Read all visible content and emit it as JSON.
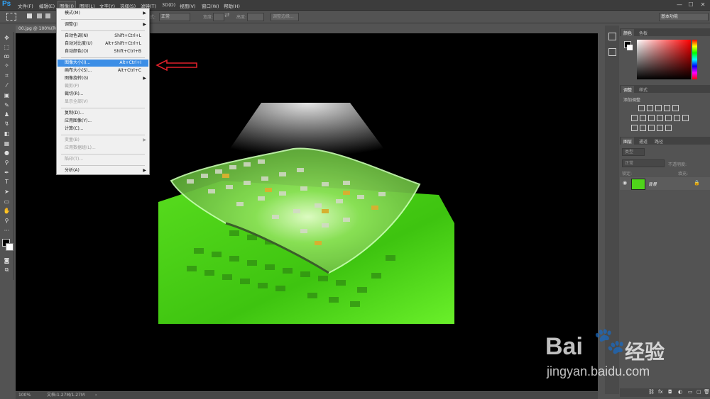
{
  "app": {
    "logo": "Ps"
  },
  "menubar": {
    "items": [
      "文件(F)",
      "编辑(E)",
      "图像(I)",
      "图层(L)",
      "文字(Y)",
      "选择(S)",
      "滤镜(T)",
      "3D(D)",
      "视图(V)",
      "窗口(W)",
      "帮助(H)"
    ],
    "window_controls": [
      "—",
      "☐",
      "✕"
    ]
  },
  "options": {
    "style_suffix": "式:",
    "mode_value": "正常",
    "width_label": "宽度:",
    "height_label": "高度:",
    "adjust_edge": "调整边缘...",
    "workspace": "基本功能"
  },
  "document": {
    "tab_title": "00.jpg @ 100%(RGB/8)"
  },
  "status": {
    "zoom": "100%",
    "doc_info": "文档:1.27M/1.27M",
    "arrow": "›"
  },
  "dropdown": {
    "items": [
      {
        "label": "模式(M)",
        "shortcut": "",
        "submenu": true,
        "disabled": false
      },
      {
        "sep": true
      },
      {
        "label": "调整(J)",
        "shortcut": "",
        "submenu": true,
        "disabled": false
      },
      {
        "sep": true
      },
      {
        "label": "自动色调(N)",
        "shortcut": "Shift+Ctrl+L",
        "submenu": false,
        "disabled": false
      },
      {
        "label": "自动对比度(U)",
        "shortcut": "Alt+Shift+Ctrl+L",
        "submenu": false,
        "disabled": false
      },
      {
        "label": "自动颜色(O)",
        "shortcut": "Shift+Ctrl+B",
        "submenu": false,
        "disabled": false
      },
      {
        "sep": true
      },
      {
        "label": "图像大小(I)...",
        "shortcut": "Alt+Ctrl+I",
        "submenu": false,
        "disabled": false,
        "highlight": true
      },
      {
        "label": "画布大小(S)...",
        "shortcut": "Alt+Ctrl+C",
        "submenu": false,
        "disabled": false
      },
      {
        "label": "图像旋转(G)",
        "shortcut": "",
        "submenu": true,
        "disabled": false
      },
      {
        "label": "裁剪(P)",
        "shortcut": "",
        "submenu": false,
        "disabled": true
      },
      {
        "label": "裁切(R)...",
        "shortcut": "",
        "submenu": false,
        "disabled": false
      },
      {
        "label": "显示全部(V)",
        "shortcut": "",
        "submenu": false,
        "disabled": true
      },
      {
        "sep": true
      },
      {
        "label": "复制(D)...",
        "shortcut": "",
        "submenu": false,
        "disabled": false
      },
      {
        "label": "应用图像(Y)...",
        "shortcut": "",
        "submenu": false,
        "disabled": false
      },
      {
        "label": "计算(C)...",
        "shortcut": "",
        "submenu": false,
        "disabled": false
      },
      {
        "sep": true
      },
      {
        "label": "变量(B)",
        "shortcut": "",
        "submenu": true,
        "disabled": true
      },
      {
        "label": "应用数据组(L)...",
        "shortcut": "",
        "submenu": false,
        "disabled": true
      },
      {
        "sep": true
      },
      {
        "label": "陷印(T)...",
        "shortcut": "",
        "submenu": false,
        "disabled": true
      },
      {
        "sep": true
      },
      {
        "label": "分析(A)",
        "shortcut": "",
        "submenu": true,
        "disabled": false
      }
    ]
  },
  "panels": {
    "color_tabs": [
      "颜色",
      "色板"
    ],
    "adjust_tabs": [
      "调整",
      "样式"
    ],
    "add_adjustment": "添加调整",
    "layers_tabs": [
      "图层",
      "通道",
      "路径"
    ],
    "filter_kind": "类型",
    "blend_mode": "正常",
    "opacity_label": "不透明度:",
    "lock_label": "锁定:",
    "fill_label": "填充:",
    "layer_name": "背景"
  },
  "watermark": {
    "brand": "Bai",
    "brand2": "经验",
    "url": "jingyan.baidu.com"
  },
  "colors": {
    "accent": "#3c8ee6",
    "arrow": "#e0202a",
    "green": "#4fd41a"
  }
}
